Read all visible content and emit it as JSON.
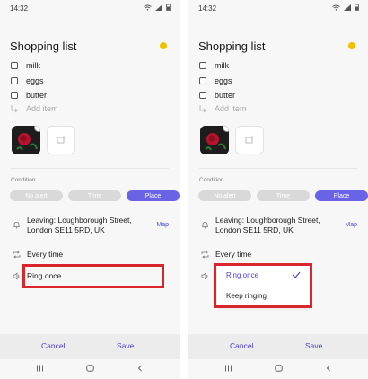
{
  "status_bar": {
    "time": "14:32"
  },
  "note": {
    "title": "Shopping list",
    "color": "#f0c000",
    "items": [
      {
        "label": "milk"
      },
      {
        "label": "eggs"
      },
      {
        "label": "butter"
      }
    ],
    "add_item_placeholder": "Add item"
  },
  "condition": {
    "label": "Condition",
    "options": [
      "No alert",
      "Time",
      "Place"
    ],
    "selected": "Place"
  },
  "location": {
    "text": "Leaving: Loughborough Street, London SE11 5RD, UK",
    "map_label": "Map"
  },
  "repeat": {
    "label": "Every time"
  },
  "ring": {
    "current": "Ring once",
    "options": [
      "Ring once",
      "Keep ringing"
    ]
  },
  "actions": {
    "cancel": "Cancel",
    "save": "Save"
  },
  "colors": {
    "accent": "#6b63e6",
    "link": "#4a3fd9",
    "highlight": "#d9252b",
    "note_dot": "#f0c000"
  },
  "icons": [
    "wifi-icon",
    "signal-icon",
    "battery-icon",
    "bell-icon",
    "repeat-icon",
    "speaker-icon",
    "image-add-icon",
    "check-icon",
    "recents-icon",
    "home-icon",
    "back-icon"
  ]
}
